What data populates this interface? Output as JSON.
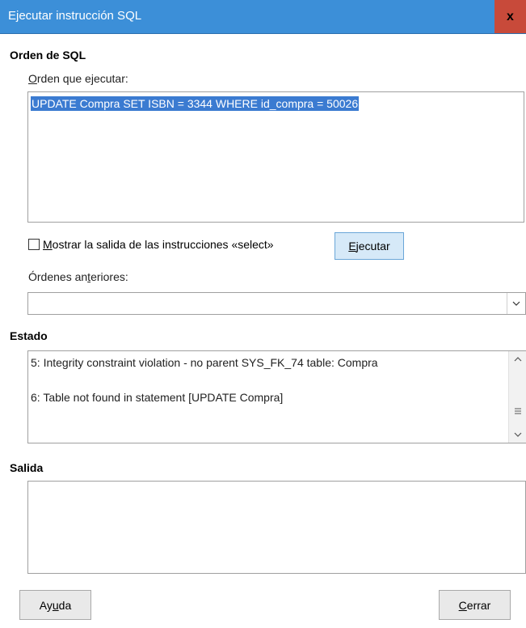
{
  "window": {
    "title": "Ejecutar instrucción SQL",
    "close_label": "x"
  },
  "sql_section": {
    "heading": "Orden de SQL",
    "command_label_u": "O",
    "command_label_rest": "rden que ejecutar:",
    "command_text": "UPDATE Compra SET ISBN = 3344 WHERE id_compra = 50026",
    "show_output_label_u": "M",
    "show_output_label_rest": "ostrar la salida de las instrucciones «select»",
    "show_output_checked": false,
    "execute_u": "E",
    "execute_rest": "jecutar",
    "previous_label_a": "Órdenes an",
    "previous_label_u": "t",
    "previous_label_b": "eriores:",
    "previous_value": ""
  },
  "status_section": {
    "heading": "Estado",
    "lines": [
      "5: Integrity constraint violation - no parent SYS_FK_74 table: Compra",
      "6: Table not found in statement [UPDATE Compra]"
    ]
  },
  "output_section": {
    "heading": "Salida",
    "text": ""
  },
  "footer": {
    "help_a": "Ay",
    "help_u": "u",
    "help_b": "da",
    "close_u": "C",
    "close_rest": "errar"
  },
  "icons": {
    "combo_arrow": "chevron-down-icon",
    "scroll_up": "chevron-up-icon",
    "scroll_down": "chevron-down-icon",
    "scroll_thumb": "grip-icon"
  },
  "colors": {
    "titlebar": "#3c8fd8",
    "close": "#c84a3a",
    "selection": "#3b7bd1",
    "execute_button": "#d6e9f8"
  }
}
